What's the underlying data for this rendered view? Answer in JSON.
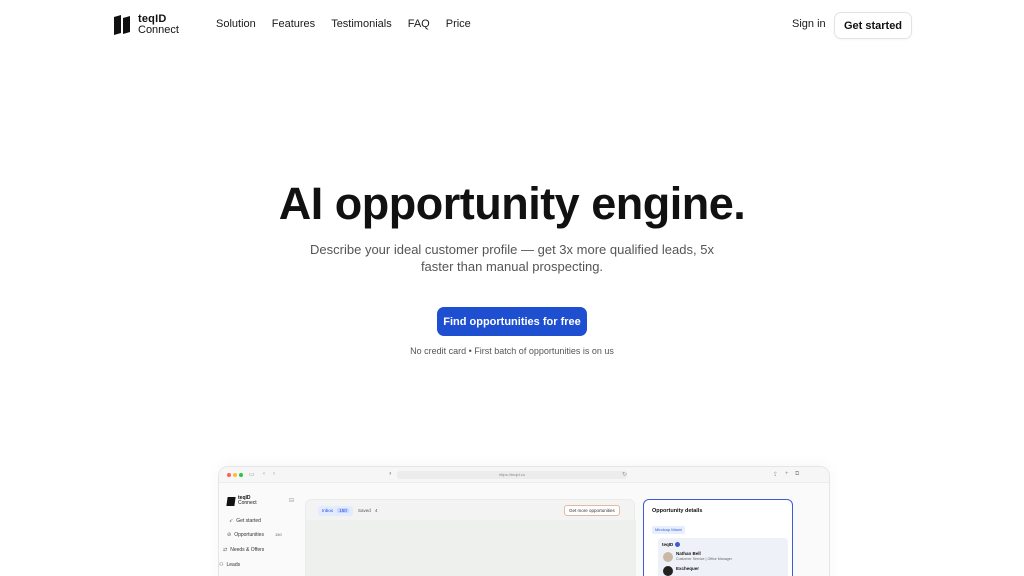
{
  "header": {
    "logo_line1": "teqID",
    "logo_line2": "Connect",
    "nav": [
      "Solution",
      "Features",
      "Testimonials",
      "FAQ",
      "Price"
    ],
    "sign_in": "Sign in",
    "get_started": "Get started"
  },
  "hero": {
    "title": "AI opportunity engine.",
    "subtitle_line1": "Describe your ideal customer profile — get 3x more qualified leads, 5x",
    "subtitle_line2": "faster than manual prospecting.",
    "cta": "Find opportunities for free",
    "note": "No credit card • First batch of opportunities is on us"
  },
  "preview": {
    "url": "https://teqid.co",
    "sidebar": {
      "logo_line1": "teqID",
      "logo_line2": "Connect",
      "items": [
        "Get started",
        "Opportunities",
        "Needs & Offers",
        "Leads"
      ],
      "opportunities_count": "150"
    },
    "main": {
      "tab_inbox": "Inbox",
      "inbox_count": "150",
      "tab_saved": "Saved",
      "saved_count": "4",
      "more_button": "Get more opportunities"
    },
    "details": {
      "title": "Opportunity details",
      "tag": "Mindcap Miami",
      "brand": "teqID",
      "person1_name": "Nathan Bell",
      "person1_role": "Customer Service | Office Manager",
      "person2_name": "Exchequer"
    }
  },
  "colors": {
    "accent": "#1f4fd1",
    "text": "#111111",
    "muted": "#555555"
  }
}
